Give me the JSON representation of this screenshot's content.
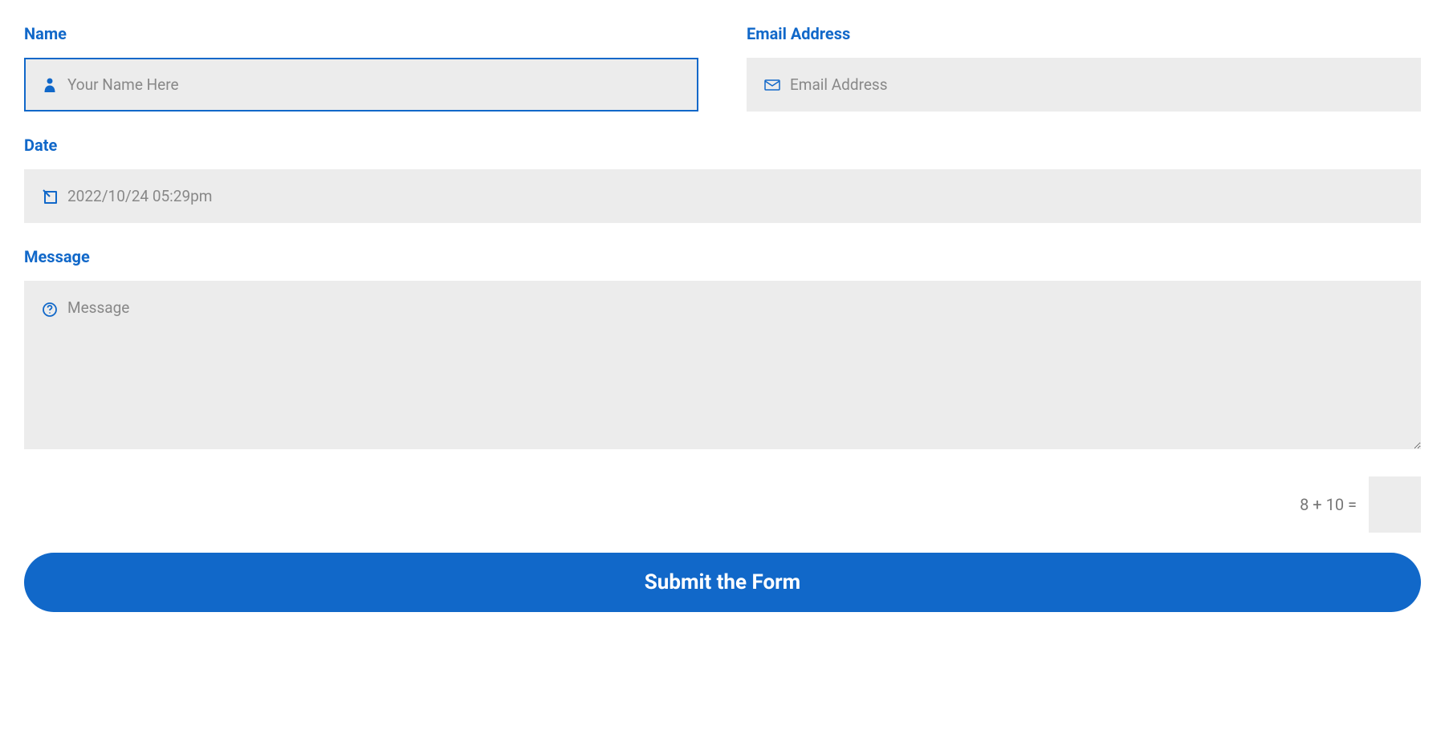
{
  "form": {
    "name": {
      "label": "Name",
      "placeholder": "Your Name Here",
      "value": ""
    },
    "email": {
      "label": "Email Address",
      "placeholder": "Email Address",
      "value": ""
    },
    "date": {
      "label": "Date",
      "placeholder": "2022/10/24 05:29pm",
      "value": ""
    },
    "message": {
      "label": "Message",
      "placeholder": "Message",
      "value": ""
    },
    "captcha": {
      "question": "8 + 10 =",
      "value": ""
    },
    "submit": {
      "label": "Submit the Form"
    }
  },
  "colors": {
    "accent": "#1168c9",
    "inputBg": "#ececec",
    "placeholder": "#888"
  }
}
